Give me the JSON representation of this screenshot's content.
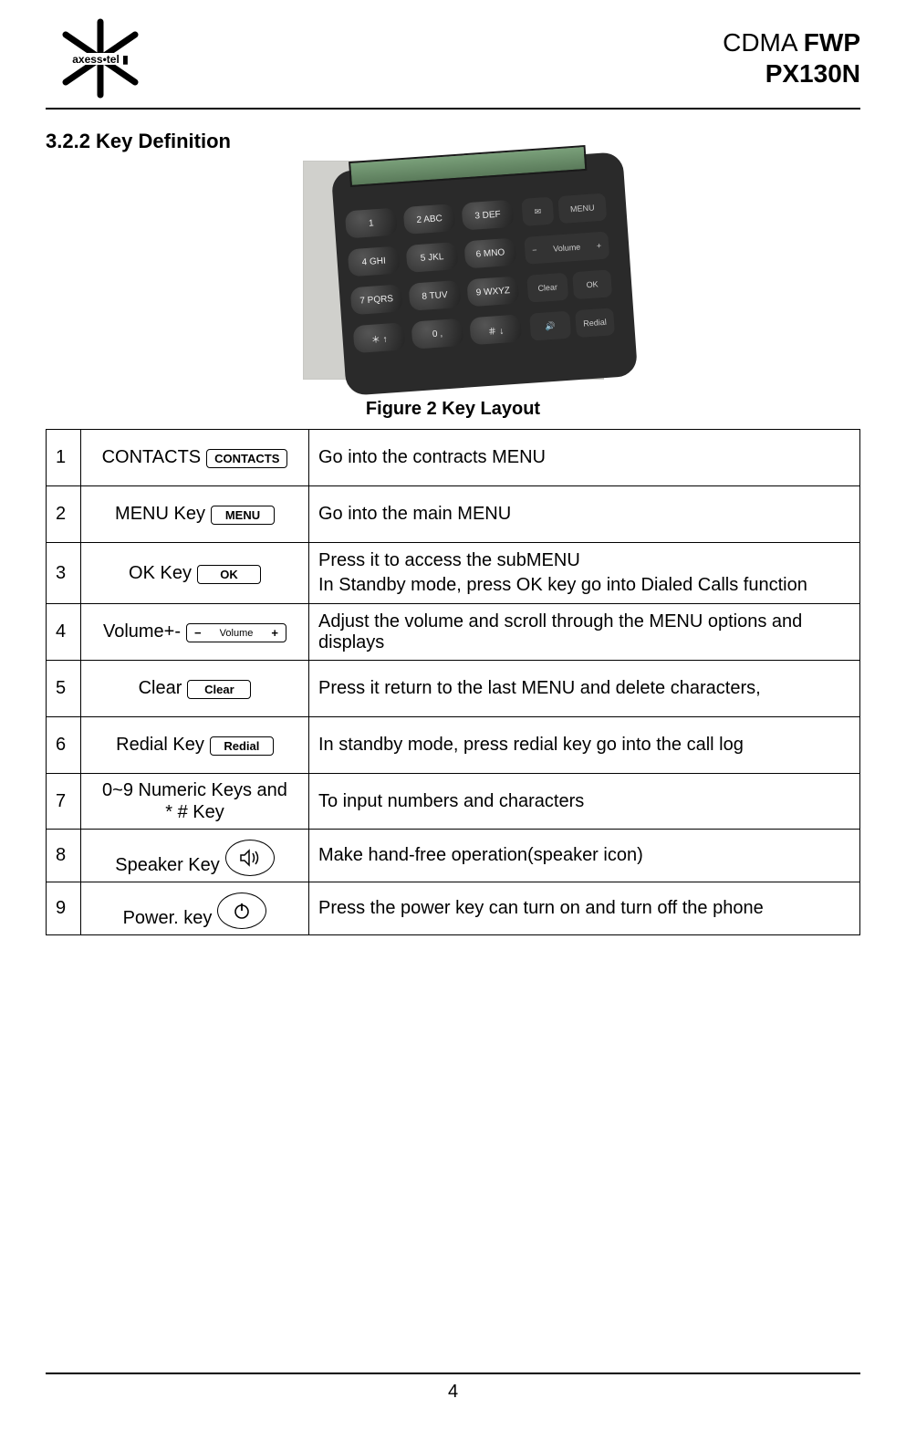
{
  "header": {
    "brand": "axess•tel",
    "title_prefix": "CDMA ",
    "title_bold": "FWP",
    "model": "PX130N"
  },
  "section_heading": "3.2.2   Key Definition",
  "figure_caption": "Figure 2 Key Layout",
  "keypad_labels": {
    "k1": "1",
    "k2": "2 ABC",
    "k3": "3 DEF",
    "k4": "4 GHI",
    "k5": "5 JKL",
    "k6": "6 MNO",
    "k7": "7 PQRS",
    "k8": "8 TUV",
    "k9": "9 WXYZ",
    "kstar": "＊ ↑",
    "k0": "0 ,",
    "khash": "＃ ↓",
    "mail": "✉",
    "menu": "MENU",
    "volminus": "−",
    "vol": "Volume",
    "volplus": "+",
    "clear": "Clear",
    "ok": "OK",
    "speaker": "🔊",
    "redial": "Redial"
  },
  "rows": [
    {
      "num": "1",
      "key_label": "CONTACTS",
      "key_icon_text": "CONTACTS",
      "icon_shape": "rect",
      "desc": "Go into the contracts MENU"
    },
    {
      "num": "2",
      "key_label": "MENU Key",
      "key_icon_text": "MENU",
      "icon_shape": "rect",
      "desc": "Go into the main MENU"
    },
    {
      "num": "3",
      "key_label": "OK Key",
      "key_icon_text": "OK",
      "icon_shape": "rect",
      "desc_line1": "Press it to access the subMENU",
      "desc_line2": "In Standby mode, press OK key  go into Dialed Calls function"
    },
    {
      "num": "4",
      "key_label": "Volume+-",
      "key_icon_left": "−",
      "key_icon_mid": "Volume",
      "key_icon_right": "+",
      "icon_shape": "rect-wide",
      "desc": "Adjust the volume and scroll through the MENU options and displays"
    },
    {
      "num": "5",
      "key_label": "Clear",
      "key_icon_text": "Clear",
      "icon_shape": "rect",
      "desc": "Press it return to the last MENU and delete characters,"
    },
    {
      "num": "6",
      "key_label": "Redial Key",
      "key_icon_text": "Redial",
      "icon_shape": "rect",
      "desc": "In standby mode, press redial key go into the call log"
    },
    {
      "num": "7",
      "key_label_line1": "0~9 Numeric Keys and",
      "key_label_line2": "* # Key",
      "icon_shape": "none",
      "desc": "To input numbers and characters"
    },
    {
      "num": "8",
      "key_label": "Speaker Key",
      "icon_shape": "oval",
      "icon_name": "speaker-icon",
      "desc": "Make hand-free operation(speaker icon)"
    },
    {
      "num": "9",
      "key_label": "Power. key",
      "icon_shape": "oval",
      "icon_name": "power-icon",
      "desc": "Press the power key can turn on and turn off  the phone"
    }
  ],
  "page_number": "4"
}
